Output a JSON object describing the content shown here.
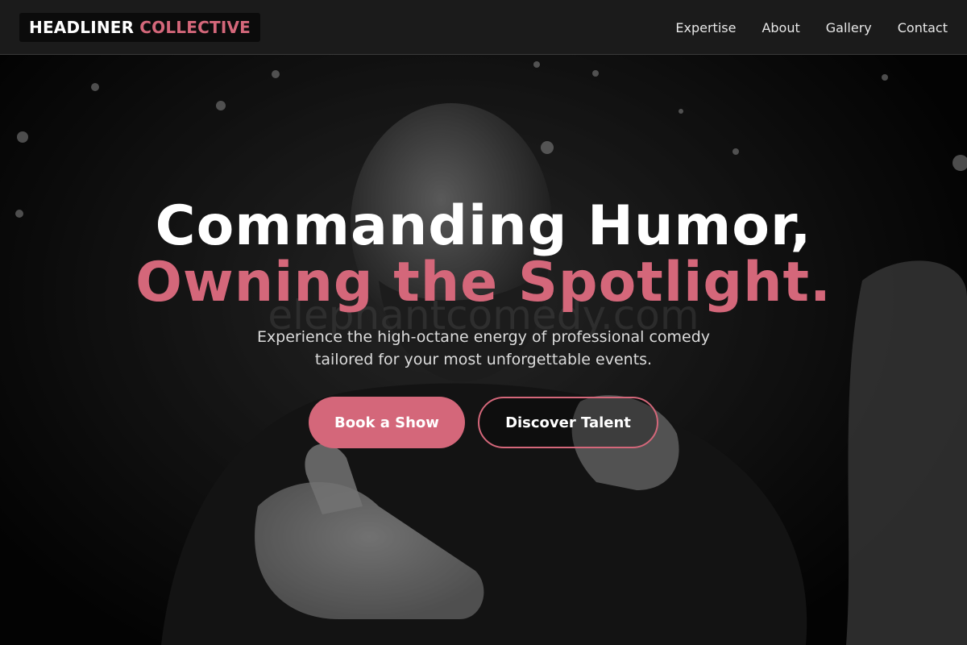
{
  "nav": {
    "logo_part1": "HEADLINER",
    "logo_part2": "COLLECTIVE",
    "links": [
      "Expertise",
      "About",
      "Gallery",
      "Contact"
    ]
  },
  "hero": {
    "headline_line1": "Commanding Humor,",
    "headline_line2": "Owning the Spotlight.",
    "subtitle": "Experience the high-octane energy of professional comedy tailored for your most unforgettable events.",
    "primary_button": "Book a Show",
    "secondary_button": "Discover Talent",
    "watermark": "elephantcomedy.com"
  },
  "colors": {
    "accent": "#d4677a",
    "nav_bg": "#1b1b1b",
    "text_light": "#ffffff"
  }
}
